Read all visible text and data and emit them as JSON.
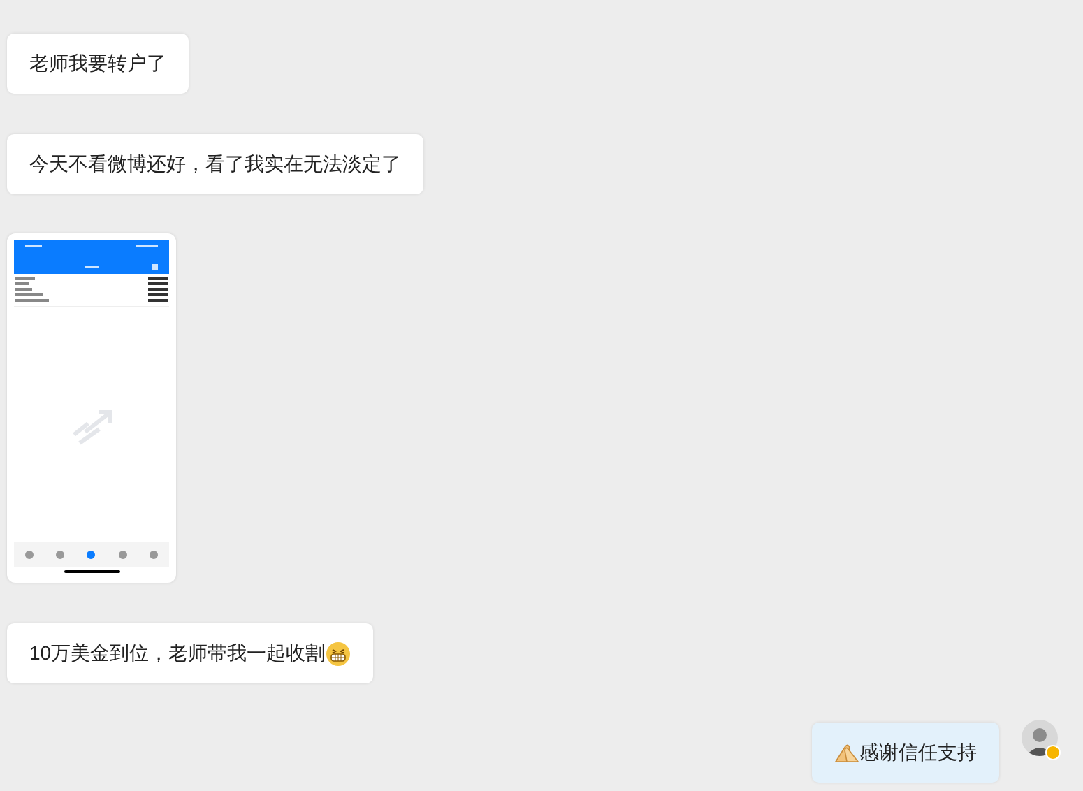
{
  "messages": [
    {
      "kind": "received",
      "text": "老师我要转户了"
    },
    {
      "kind": "received",
      "text": "今天不看微博还好，看了我实在无法淡定了"
    },
    {
      "kind": "image"
    },
    {
      "kind": "received",
      "text": "10万美金到位，老师带我一起收割",
      "grin_emoji": true
    },
    {
      "kind": "sent",
      "text": "感谢信任支持",
      "hands_emoji": true,
      "verified": true
    }
  ]
}
